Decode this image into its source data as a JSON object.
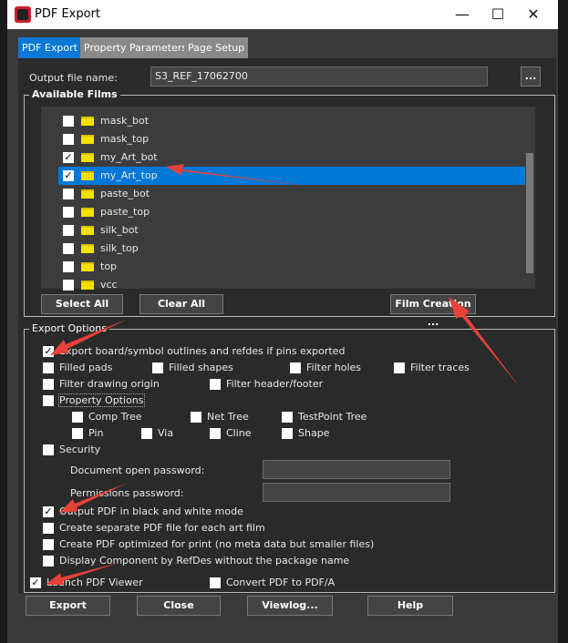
{
  "window": {
    "title": "PDF Export",
    "minimize": "—",
    "maximize": "☐",
    "close": "✕"
  },
  "tabs": [
    {
      "label": "PDF Export",
      "active": true
    },
    {
      "label": "Property Parameters"
    },
    {
      "label": "Page Setup"
    }
  ],
  "output": {
    "label": "Output file name:",
    "value": "S3_REF_17062700",
    "browse": "..."
  },
  "films": {
    "title": "Available Films",
    "items": [
      {
        "name": "mask_bot",
        "checked": false
      },
      {
        "name": "mask_top",
        "checked": false
      },
      {
        "name": "my_Art_bot",
        "checked": true
      },
      {
        "name": "my_Art_top",
        "checked": true,
        "selected": true
      },
      {
        "name": "paste_bot",
        "checked": false
      },
      {
        "name": "paste_top",
        "checked": false
      },
      {
        "name": "silk_bot",
        "checked": false
      },
      {
        "name": "silk_top",
        "checked": false
      },
      {
        "name": "top",
        "checked": false
      },
      {
        "name": "vcc",
        "checked": false
      }
    ],
    "select_all": "Select All",
    "clear_all": "Clear All",
    "film_creation": "Film Creation ..."
  },
  "export_options": {
    "title": "Export Options",
    "export_outlines": "Export board/symbol outlines and refdes if pins exported",
    "filled_pads": "Filled pads",
    "filled_shapes": "Filled shapes",
    "filter_holes": "Filter holes",
    "filter_traces": "Filter traces",
    "filter_origin": "Filter drawing origin",
    "filter_header": "Filter header/footer",
    "property_options": "Property Options",
    "comp_tree": "Comp Tree",
    "net_tree": "Net Tree",
    "testpoint_tree": "TestPoint Tree",
    "pin": "Pin",
    "via": "Via",
    "cline": "Cline",
    "shape": "Shape",
    "security": "Security",
    "doc_password": "Document open password:",
    "perm_password": "Permissions password:",
    "bw_mode": "Output PDF in black and white mode",
    "separate": "Create separate PDF file for each art film",
    "optimized": "Create PDF optimized for print (no meta data but smaller files)",
    "display_refdes": "Display Component by RefDes without the package name"
  },
  "launch_viewer": "Launch PDF Viewer",
  "convert_pdfa": "Convert PDF to PDF/A",
  "buttons": {
    "export": "Export",
    "close": "Close",
    "viewlog": "Viewlog...",
    "help": "Help"
  },
  "colors": {
    "accent": "#0078d7",
    "annotation_arrow": "#e8413a"
  }
}
